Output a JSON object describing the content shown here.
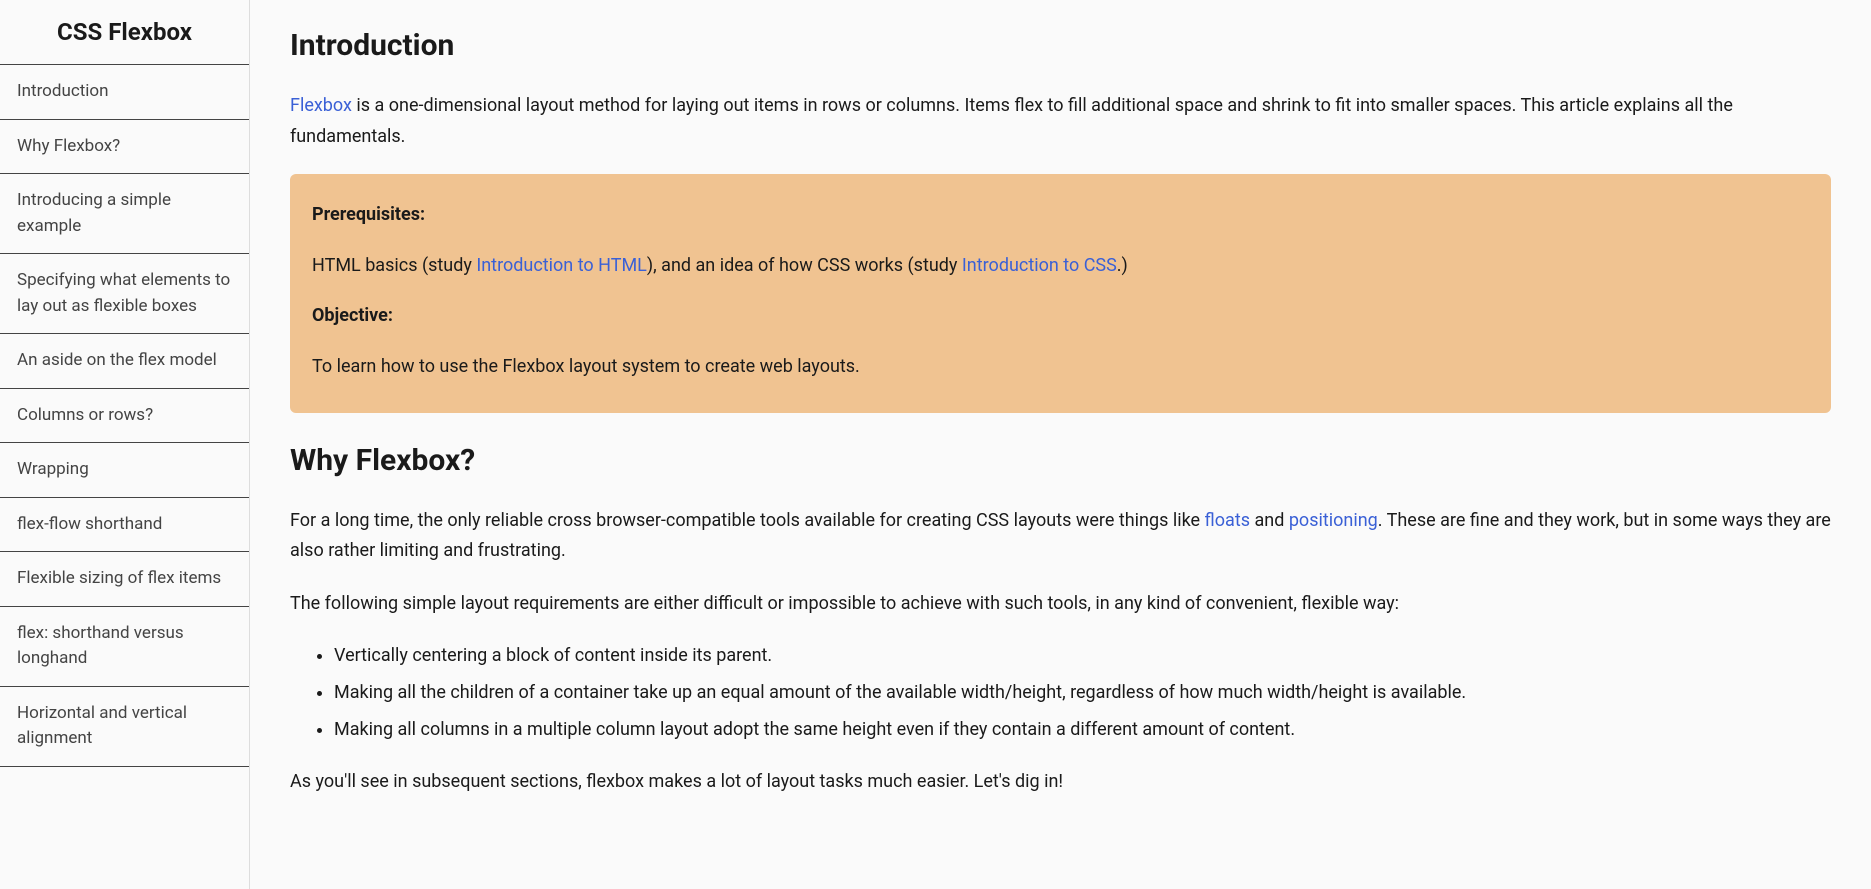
{
  "sidebar": {
    "title": "CSS Flexbox",
    "items": [
      "Introduction",
      "Why Flexbox?",
      "Introducing a simple example",
      "Specifying what elements to lay out as flexible boxes",
      "An aside on the flex model",
      "Columns or rows?",
      "Wrapping",
      "flex-flow shorthand",
      "Flexible sizing of flex items",
      "flex: shorthand versus longhand",
      "Horizontal and vertical alignment"
    ]
  },
  "main": {
    "intro": {
      "heading": "Introduction",
      "link": "Flexbox",
      "text_after": " is a one-dimensional layout method for laying out items in rows or columns. Items flex to fill additional space and shrink to fit into smaller spaces. This article explains all the fundamentals."
    },
    "callout": {
      "prereq_label": "Prerequisites:",
      "prereq_t1": "HTML basics (study ",
      "prereq_link1": "Introduction to HTML",
      "prereq_t2": "), and an idea of how CSS works (study ",
      "prereq_link2": "Introduction to CSS",
      "prereq_t3": ".)",
      "obj_label": "Objective:",
      "obj_text": "To learn how to use the Flexbox layout system to create web layouts."
    },
    "why": {
      "heading": "Why Flexbox?",
      "p1_t1": "For a long time, the only reliable cross browser-compatible tools available for creating CSS layouts were things like ",
      "p1_link1": "floats",
      "p1_t2": " and ",
      "p1_link2": "positioning",
      "p1_t3": ". These are fine and they work, but in some ways they are also rather limiting and frustrating.",
      "p2": "The following simple layout requirements are either difficult or impossible to achieve with such tools, in any kind of convenient, flexible way:",
      "bullets": [
        "Vertically centering a block of content inside its parent.",
        "Making all the children of a container take up an equal amount of the available width/height, regardless of how much width/height is available.",
        "Making all columns in a multiple column layout adopt the same height even if they contain a different amount of content."
      ],
      "p3": "As you'll see in subsequent sections, flexbox makes a lot of layout tasks much easier. Let's dig in!"
    }
  }
}
